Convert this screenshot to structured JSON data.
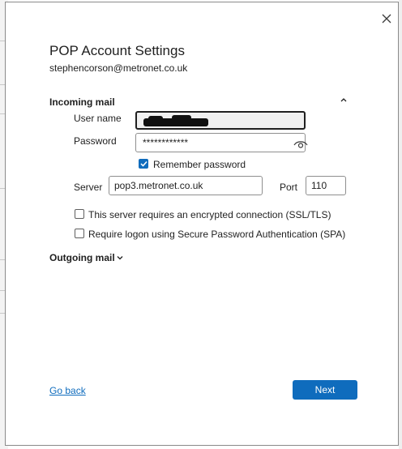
{
  "dialog": {
    "title": "POP Account Settings",
    "email": "stephencorson@metronet.co.uk",
    "close_label": "×"
  },
  "incoming": {
    "heading": "Incoming mail",
    "username_label": "User name",
    "username_value": "",
    "password_label": "Password",
    "password_value": "************",
    "remember_label": "Remember password",
    "remember_checked": true,
    "server_label": "Server",
    "server_value": "pop3.metronet.co.uk",
    "port_label": "Port",
    "port_value": "110",
    "ssl_label": "This server requires an encrypted connection (SSL/TLS)",
    "ssl_checked": false,
    "spa_label": "Require logon using Secure Password Authentication (SPA)",
    "spa_checked": false
  },
  "outgoing": {
    "heading": "Outgoing mail"
  },
  "footer": {
    "back_label": "Go back",
    "next_label": "Next"
  },
  "colors": {
    "accent": "#0f6cbd",
    "text": "#1f1f1f"
  }
}
